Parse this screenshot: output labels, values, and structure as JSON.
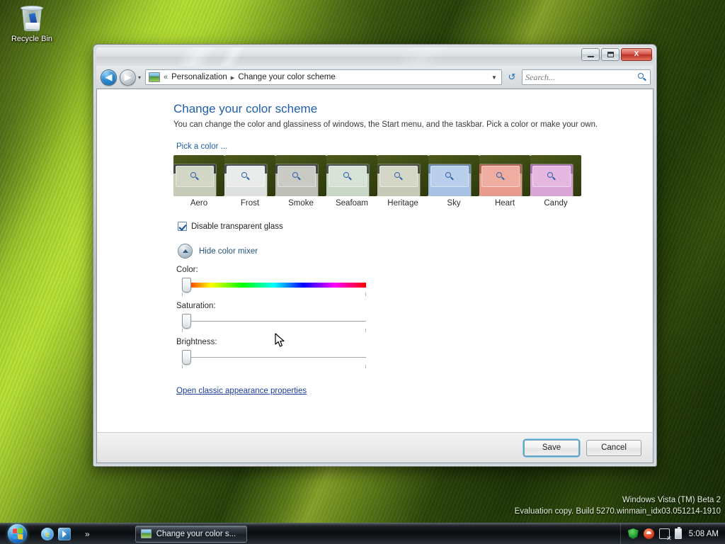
{
  "desktop": {
    "recycle_bin_label": "Recycle Bin",
    "watermark_line1": "Windows Vista (TM) Beta 2",
    "watermark_line2": "Evaluation copy. Build 5270.winmain_idx03.051214-1910"
  },
  "window": {
    "minimize_label": "Minimize",
    "maximize_label": "Maximize",
    "close_label": "X",
    "nav": {
      "back_glyph": "◀",
      "forward_glyph": "▶",
      "history_glyph": "▾",
      "breadcrumb_overflow": "«",
      "crumb1": "Personalization",
      "crumb_sep": "▸",
      "crumb2": "Change your color scheme",
      "address_dropdown_glyph": "▼",
      "refresh_glyph": "↺"
    },
    "search": {
      "value": "",
      "placeholder": "Search..."
    }
  },
  "content": {
    "title": "Change your color scheme",
    "subtitle": "You can change the color and glassiness of windows, the Start menu, and the taskbar. Pick a color or make your own.",
    "pick_color_label": "Pick a color ...",
    "swatches": [
      {
        "name": "Aero",
        "title_color": "#3f444a",
        "body_color": "#d2d6c4",
        "frame_color": "#c6cbb9"
      },
      {
        "name": "Frost",
        "title_color": "#4a4f55",
        "body_color": "#e9eaea",
        "frame_color": "#dedfdf"
      },
      {
        "name": "Smoke",
        "title_color": "#44484c",
        "body_color": "#c9cac4",
        "frame_color": "#bdbeb8"
      },
      {
        "name": "Seafoam",
        "title_color": "#4a5450",
        "body_color": "#d6e2d6",
        "frame_color": "#c8d6c8"
      },
      {
        "name": "Heritage",
        "title_color": "#4c4f45",
        "body_color": "#d5d7c6",
        "frame_color": "#c7c9b8"
      },
      {
        "name": "Sky",
        "title_color": "#6b87ab",
        "body_color": "#b9ceea",
        "frame_color": "#a8c1e2"
      },
      {
        "name": "Heart",
        "title_color": "#b26257",
        "body_color": "#eeada0",
        "frame_color": "#e79b8d"
      },
      {
        "name": "Candy",
        "title_color": "#a872b4",
        "body_color": "#e4b6e0",
        "frame_color": "#daa6d6"
      }
    ],
    "glass_checkbox": {
      "label": "Disable transparent glass",
      "checked": "true"
    },
    "mixer": {
      "toggle_label": "Hide color mixer",
      "toggle_glyph": "▲",
      "sliders": [
        {
          "label": "Color:",
          "type": "hue",
          "value": 0
        },
        {
          "label": "Saturation:",
          "type": "plain",
          "value": 0
        },
        {
          "label": "Brightness:",
          "type": "plain",
          "value": 0
        }
      ]
    },
    "classic_link": "Open classic appearance properties"
  },
  "commandbar": {
    "save_label": "Save",
    "cancel_label": "Cancel"
  },
  "taskbar": {
    "start_label": "Start",
    "quicklaunch_overflow": "»",
    "task_label": "Change your color s...",
    "clock": "5:08 AM"
  },
  "colors": {
    "accent_blue": "#1f5fa8",
    "link_blue": "#1b3fa0",
    "focus_ring": "#4fa8d8",
    "close_red": "#bb3326"
  }
}
